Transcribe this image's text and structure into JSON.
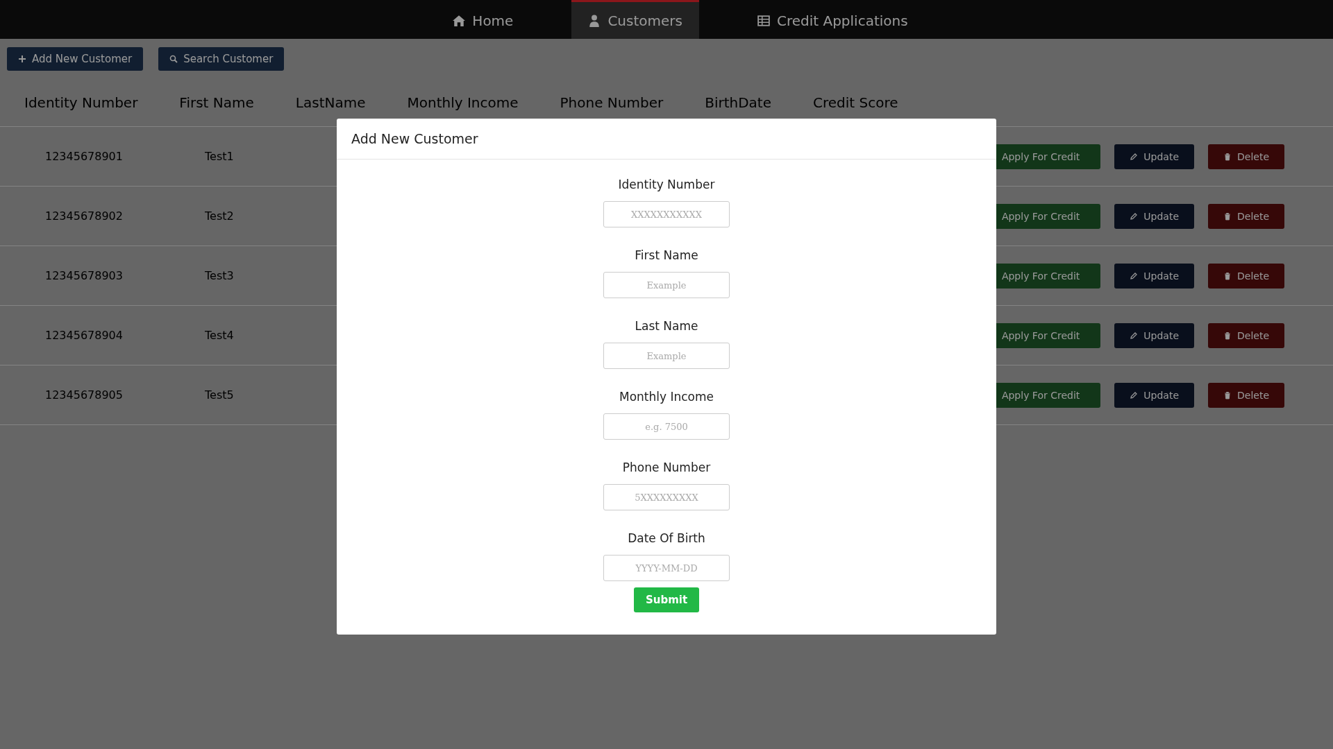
{
  "navbar": {
    "items": [
      {
        "label": "Home",
        "selected": false
      },
      {
        "label": "Customers",
        "selected": true
      },
      {
        "label": "Credit Applications",
        "selected": false
      }
    ]
  },
  "toolbar": {
    "buttons": [
      {
        "label": "Add New Customer"
      },
      {
        "label": "Search Customer"
      }
    ]
  },
  "table": {
    "columns": [
      "Identity Number",
      "First Name",
      "LastName",
      "Monthly Income",
      "Phone Number",
      "BirthDate",
      "Credit Score"
    ],
    "rows": [
      {
        "identity_number": "12345678901",
        "first_name": "Test1",
        "actions": [
          {
            "kind": "apply",
            "label": "Apply For Credit"
          },
          {
            "kind": "update",
            "label": "Update"
          },
          {
            "kind": "delete",
            "label": "Delete"
          }
        ]
      },
      {
        "identity_number": "12345678902",
        "first_name": "Test2",
        "actions": [
          {
            "kind": "apply",
            "label": "Apply For Credit"
          },
          {
            "kind": "update",
            "label": "Update"
          },
          {
            "kind": "delete",
            "label": "Delete"
          }
        ]
      },
      {
        "identity_number": "12345678903",
        "first_name": "Test3",
        "actions": [
          {
            "kind": "apply",
            "label": "Apply For Credit"
          },
          {
            "kind": "update",
            "label": "Update"
          },
          {
            "kind": "delete",
            "label": "Delete"
          }
        ]
      },
      {
        "identity_number": "12345678904",
        "first_name": "Test4",
        "actions": [
          {
            "kind": "apply",
            "label": "Apply For Credit"
          },
          {
            "kind": "update",
            "label": "Update"
          },
          {
            "kind": "delete",
            "label": "Delete"
          }
        ]
      },
      {
        "identity_number": "12345678905",
        "first_name": "Test5",
        "actions": [
          {
            "kind": "apply",
            "label": "Apply For Credit"
          },
          {
            "kind": "update",
            "label": "Update"
          },
          {
            "kind": "delete",
            "label": "Delete"
          }
        ]
      }
    ]
  },
  "modal": {
    "title": "Add New Customer",
    "fields": [
      {
        "label": "Identity Number",
        "placeholder": "XXXXXXXXXXX"
      },
      {
        "label": "First Name",
        "placeholder": "Example"
      },
      {
        "label": "Last Name",
        "placeholder": "Example"
      },
      {
        "label": "Monthly Income",
        "placeholder": "e.g. 7500"
      },
      {
        "label": "Phone Number",
        "placeholder": "5XXXXXXXXX"
      },
      {
        "label": "Date Of Birth",
        "placeholder": "YYYY-MM-DD"
      }
    ],
    "submit": "Submit"
  }
}
